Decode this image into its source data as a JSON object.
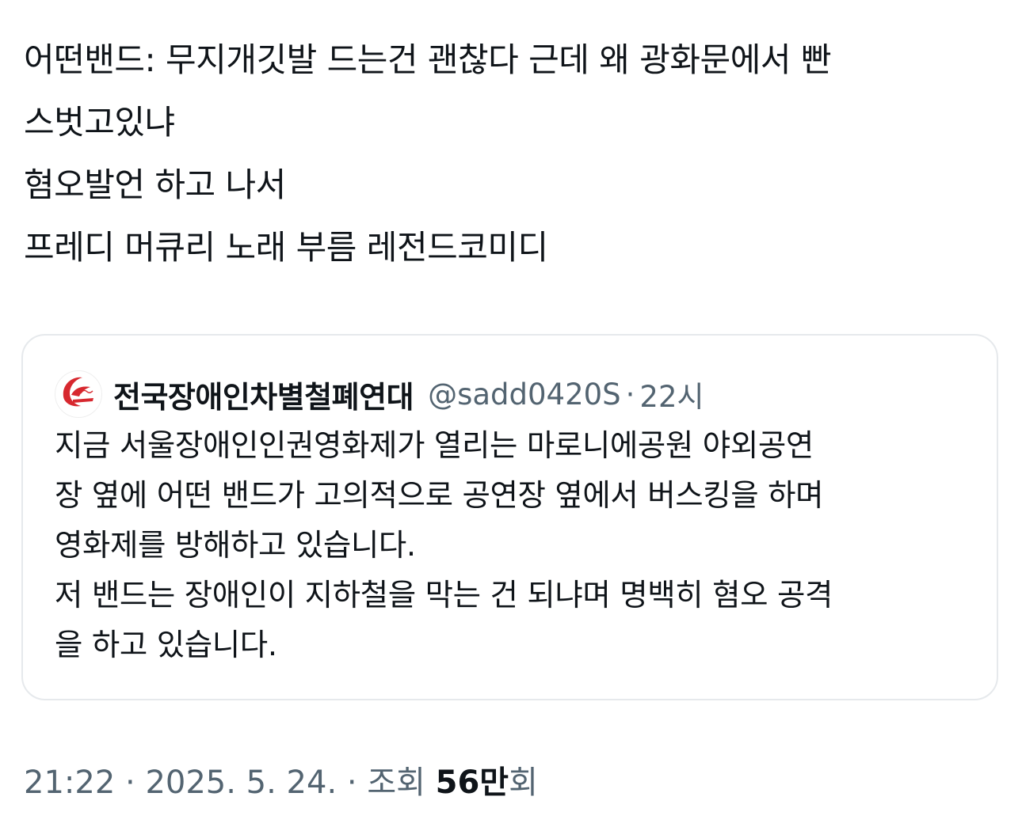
{
  "tweet": {
    "text_lines": [
      "어떤밴드: 무지개깃발 드는건 괜찮다 근데 왜 광화문에서 빤",
      "스벗고있냐",
      "혐오발언 하고 나서",
      "프레디 머큐리 노래 부름 레전드코미디"
    ]
  },
  "quote": {
    "author_name": "전국장애인차별철폐연대",
    "handle": "@sadd0420S",
    "separator": "·",
    "time": "22시",
    "avatar_icon": "organization-logo-icon",
    "text_lines": [
      "지금 서울장애인인권영화제가 열리는 마로니에공원 야외공연",
      "장 옆에 어떤 밴드가 고의적으로 공연장 옆에서 버스킹을 하며",
      "영화제를 방해하고 있습니다.",
      "저 밴드는 장애인이 지하철을 막는 건 되냐며 명백히 혐오 공격",
      "을 하고 있습니다."
    ]
  },
  "meta": {
    "time": "21:22",
    "sep1": "·",
    "date": "2025. 5. 24.",
    "sep2": "·",
    "views_label_prefix": "조회",
    "views_count": "56만",
    "views_label_suffix": "회"
  },
  "colors": {
    "text_primary": "#0f1419",
    "text_secondary": "#536471",
    "card_border": "#e6e9ec",
    "logo_red": "#d7282f"
  }
}
